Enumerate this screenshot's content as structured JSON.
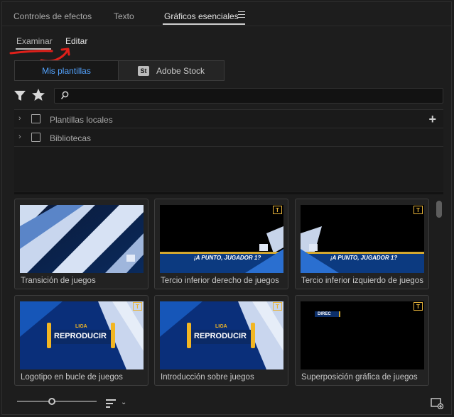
{
  "tabs": [
    {
      "label": "Controles de efectos"
    },
    {
      "label": "Texto"
    },
    {
      "label": "Gráficos esenciales"
    }
  ],
  "subtabs": {
    "explore": "Examinar",
    "edit": "Editar"
  },
  "segments": {
    "mine": "Mis plantillas",
    "stock_badge": "St",
    "stock": "Adobe Stock"
  },
  "search": {
    "placeholder": "",
    "value": ""
  },
  "libraries": [
    {
      "label": "Plantillas locales"
    },
    {
      "label": "Bibliotecas"
    }
  ],
  "templates": [
    {
      "title": "Transición de juegos",
      "thumb_text": ""
    },
    {
      "title": "Tercio inferior derecho de juegos",
      "thumb_text": "¡A PUNTO, JUGADOR 1?",
      "badge": "T"
    },
    {
      "title": "Tercio inferior izquierdo de juegos",
      "thumb_text": "¡A PUNTO, JUGADOR 1?",
      "badge": "T"
    },
    {
      "title": "Logotipo en bucle de juegos",
      "thumb_text_top": "LIGA",
      "thumb_text": "REPRODUCIR",
      "badge": "T"
    },
    {
      "title": "Introducción sobre juegos",
      "thumb_text_top": "LIGA",
      "thumb_text": "REPRODUCIR",
      "badge": "T"
    },
    {
      "title": "Superposición gráfica de juegos",
      "thumb_text": "DIREC",
      "badge": "T"
    }
  ],
  "colors": {
    "accent": "#53a3ff",
    "badge": "#e8b43a",
    "annotation": "#e0201a"
  }
}
